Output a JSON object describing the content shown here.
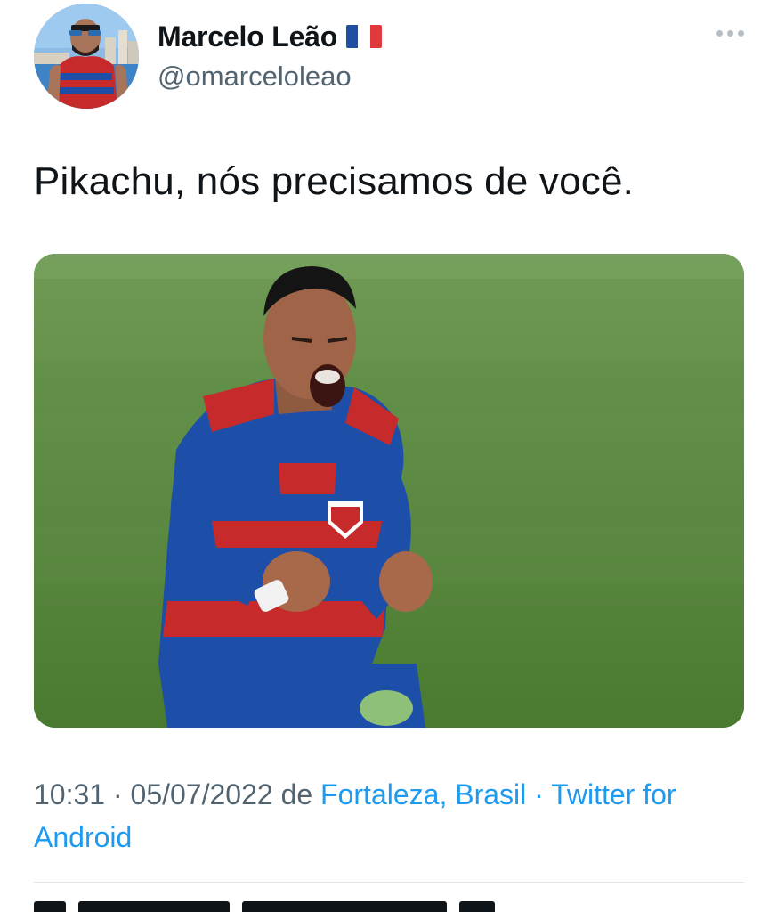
{
  "user": {
    "display_name": "Marcelo Leão",
    "handle": "@omarceloleao",
    "flag_icon": "france-flag-icon"
  },
  "tweet": {
    "text": "Pikachu, nós precisamos de você.",
    "time": "10:31",
    "date": "05/07/2022",
    "from_word": "de",
    "location": "Fortaleza, Brasil",
    "source": "Twitter for Android"
  },
  "colors": {
    "link": "#1d9bf0",
    "secondary_text": "#536471",
    "pitch_green": "#4f7d38",
    "jersey_blue": "#1e4fa8",
    "jersey_red": "#c62a2a"
  }
}
